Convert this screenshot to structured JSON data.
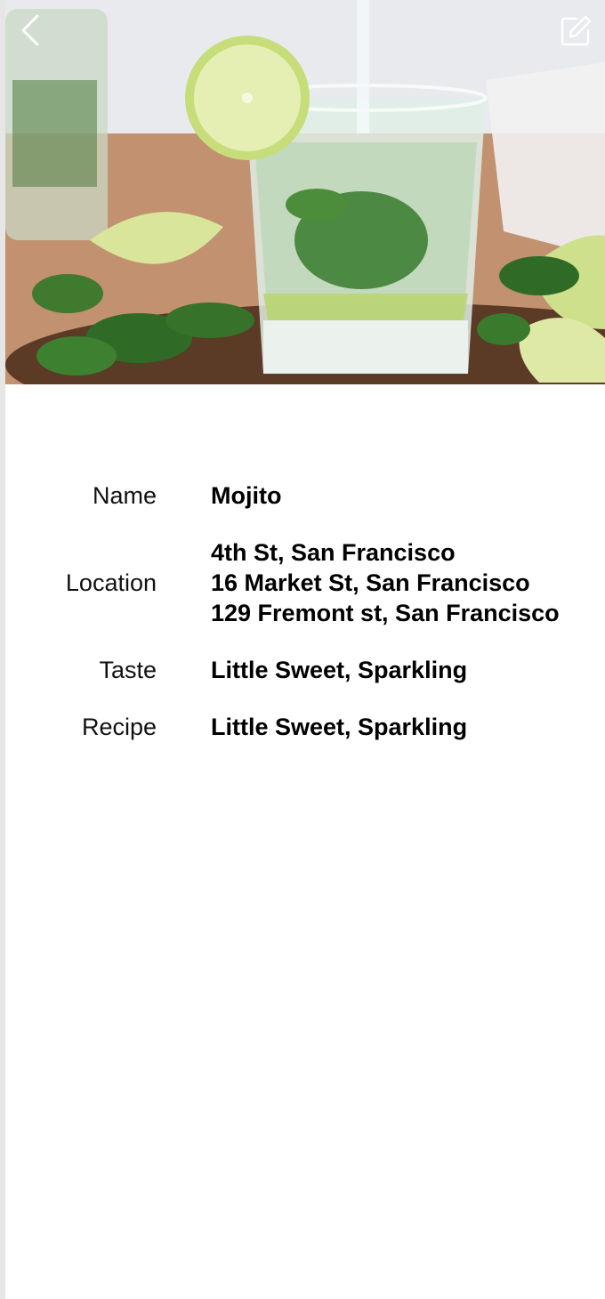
{
  "header": {
    "back_icon": "chevron-left-icon",
    "edit_icon": "edit-note-icon",
    "hero_image": "mojito-glass-photo"
  },
  "details": {
    "name_label": "Name",
    "name_value": "Mojito",
    "location_label": "Location",
    "locations": [
      "4th St, San Francisco",
      "16 Market St, San Francisco",
      "129 Fremont st, San Francisco"
    ],
    "taste_label": "Taste",
    "taste_value": "Little Sweet, Sparkling",
    "recipe_label": "Recipe",
    "recipe_value": "Little Sweet, Sparkling"
  },
  "colors": {
    "text": "#000000",
    "label": "#111111",
    "background": "#ffffff",
    "icon": "#ffffff"
  }
}
